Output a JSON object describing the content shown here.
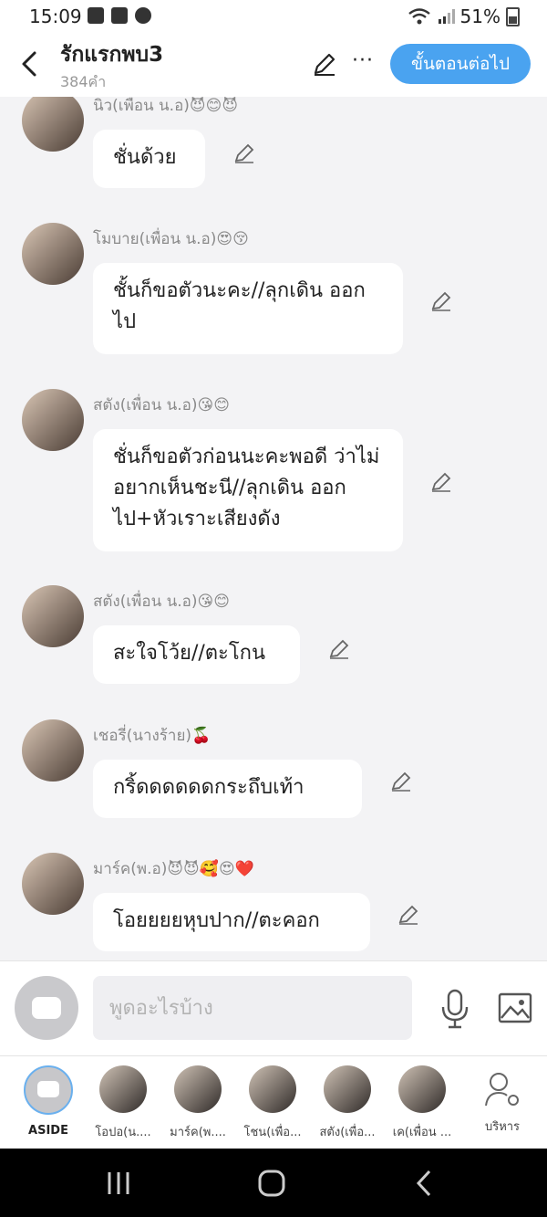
{
  "status": {
    "time": "15:09",
    "battery": "51%"
  },
  "header": {
    "title": "รักแรกพบ3",
    "subtitle": "384คำ",
    "more": "···",
    "next_label": "ขั้นตอนต่อไป"
  },
  "messages": [
    {
      "name": "นิว(เพื่อน น.อ)😈😊😈",
      "text": "ชั่นด้วย"
    },
    {
      "name": "โมบาย(เพื่อน น.อ)😍😚",
      "text": "ชั้นก็ขอตัวนะคะ//ลุกเดิน ออกไป"
    },
    {
      "name": "สตัง(เพื่อน น.อ)😘😊",
      "text": "ชั่นก็ขอตัวก่อนนะคะพอดี ว่าไม่อยากเห็นชะนี//ลุกเดิน ออกไป+หัวเราะเสียงดัง"
    },
    {
      "name": "สตัง(เพื่อน น.อ)😘😊",
      "text": "สะใจโว้ย//ตะโกน"
    },
    {
      "name": "เชอรี่(นางร้าย)🍒",
      "text": "กริ้ดดดดดดกระถึบเท้า"
    },
    {
      "name": "มาร์ค(พ.อ)😈😈🥰😍❤️",
      "text": "โอยยยยหุบปาก//ตะคอก"
    }
  ],
  "input": {
    "placeholder": "พูดอะไรบ้าง"
  },
  "cast": [
    {
      "label": "ASIDE"
    },
    {
      "label": "โอปอ(น...."
    },
    {
      "label": "มาร์ค(พ...."
    },
    {
      "label": "โชน(เพื่อ..."
    },
    {
      "label": "สตัง(เพื่อ..."
    },
    {
      "label": "เค(เพื่อน ..."
    },
    {
      "label": "บริหาร"
    }
  ],
  "colors": {
    "accent": "#4aa3f0",
    "background": "#f3f3f5"
  }
}
